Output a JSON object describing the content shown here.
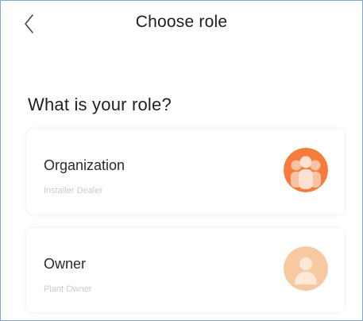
{
  "header": {
    "title": "Choose role",
    "back_icon": "chevron-left-icon"
  },
  "main": {
    "question": "What is your role?",
    "roles": [
      {
        "title": "Organization",
        "subtitle": "Installer Dealer",
        "icon": "group-icon",
        "accent": "#f57c3c"
      },
      {
        "title": "Owner",
        "subtitle": "Plant Owner",
        "icon": "person-icon",
        "accent": "#f7c9a1"
      }
    ]
  }
}
